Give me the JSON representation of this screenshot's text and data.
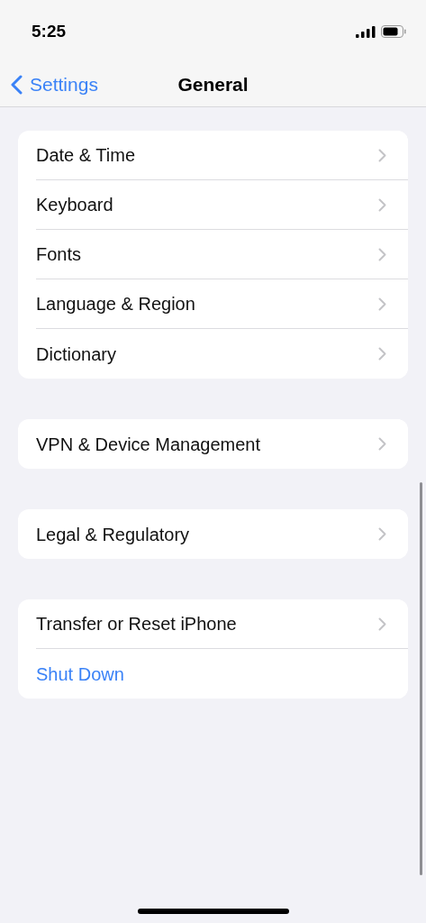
{
  "status_bar": {
    "time": "5:25"
  },
  "nav_bar": {
    "back": "Settings",
    "title": "General"
  },
  "groups": [
    {
      "items": [
        {
          "label": "Date & Time",
          "kind": "link"
        },
        {
          "label": "Keyboard",
          "kind": "link"
        },
        {
          "label": "Fonts",
          "kind": "link"
        },
        {
          "label": "Language & Region",
          "kind": "link"
        },
        {
          "label": "Dictionary",
          "kind": "link"
        }
      ]
    },
    {
      "items": [
        {
          "label": "VPN & Device Management",
          "kind": "link"
        }
      ]
    },
    {
      "items": [
        {
          "label": "Legal & Regulatory",
          "kind": "link"
        }
      ]
    },
    {
      "items": [
        {
          "label": "Transfer or Reset iPhone",
          "kind": "link"
        },
        {
          "label": "Shut Down",
          "kind": "action"
        }
      ]
    }
  ]
}
